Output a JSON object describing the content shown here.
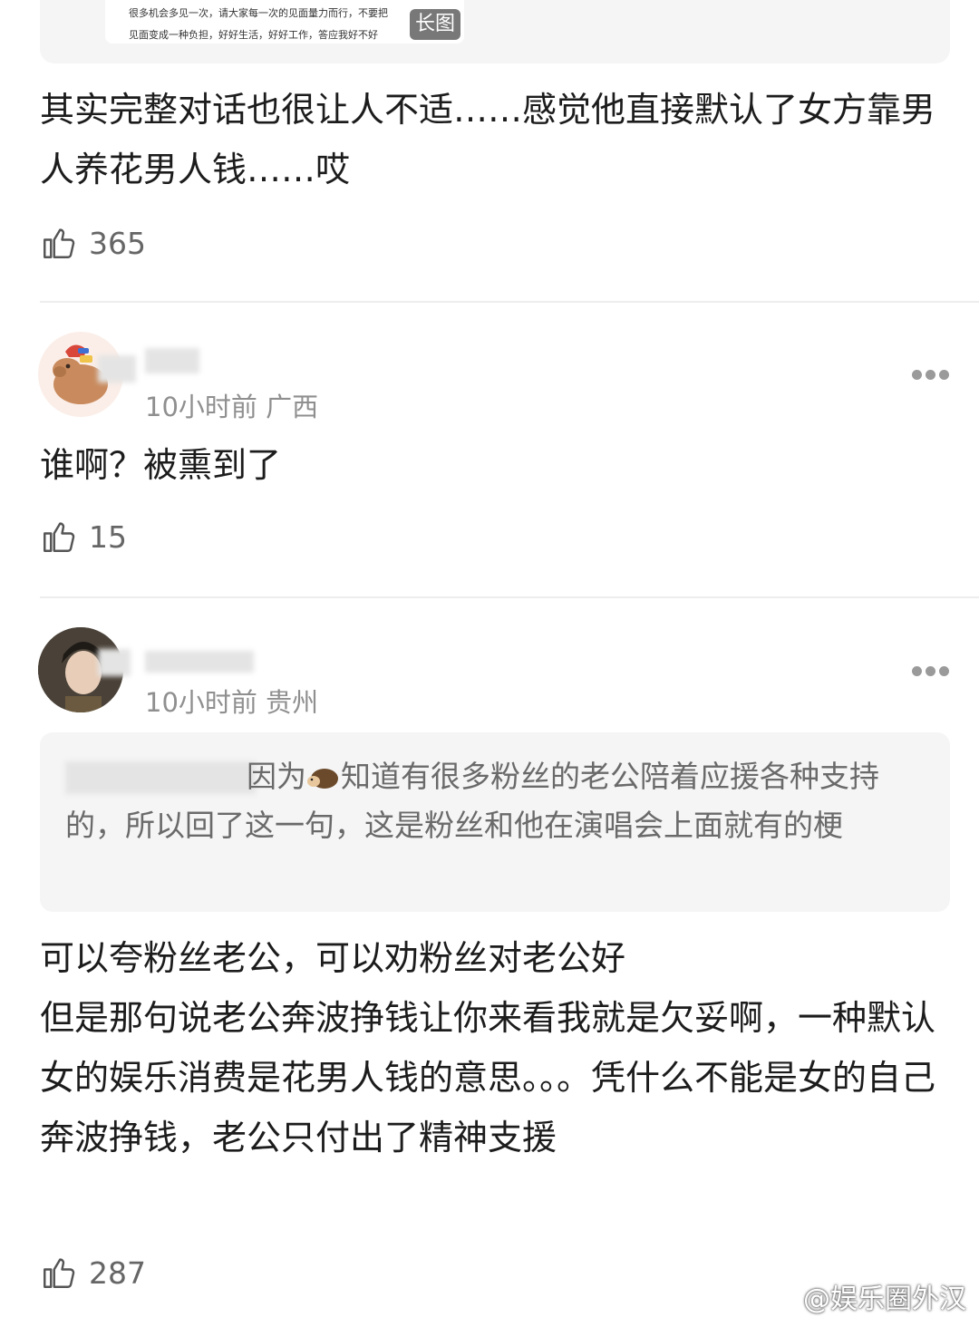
{
  "top_quote": {
    "line1": "很多机会多见一次，请大家每一次的见面量力而行，不要把",
    "line2": "见面变成一种负担，好好生活，好好工作，答应我好不好",
    "badge": "长图"
  },
  "comments": [
    {
      "text": "其实完整对话也很让人不适……感觉他直接默认了女方靠男人养花男人钱……哎",
      "likes": "365"
    },
    {
      "meta": "10小时前 广西",
      "text": "谁啊？被熏到了",
      "likes": "15"
    },
    {
      "meta": "10小时前 贵州",
      "quote": {
        "before": "因为",
        "after": "知道有很多粉丝的老公陪着应援各种支持的，所以回了这一句，这是粉丝和他在演唱会上面就有的梗"
      },
      "text_lines": [
        "可以夸粉丝老公，可以劝粉丝对老公好",
        "但是那句说老公奔波挣钱让你来看我就是欠妥啊，一种默认女的娱乐消费是花男人钱的意思。。。凭什么不能是女的自己奔波挣钱，老公只付出了精神支援"
      ],
      "likes": "287"
    }
  ],
  "watermark": "@娱乐圈外汉",
  "icons": [
    "thumbs-up-icon",
    "more-icon",
    "weibo-icon",
    "hedgehog-icon"
  ]
}
